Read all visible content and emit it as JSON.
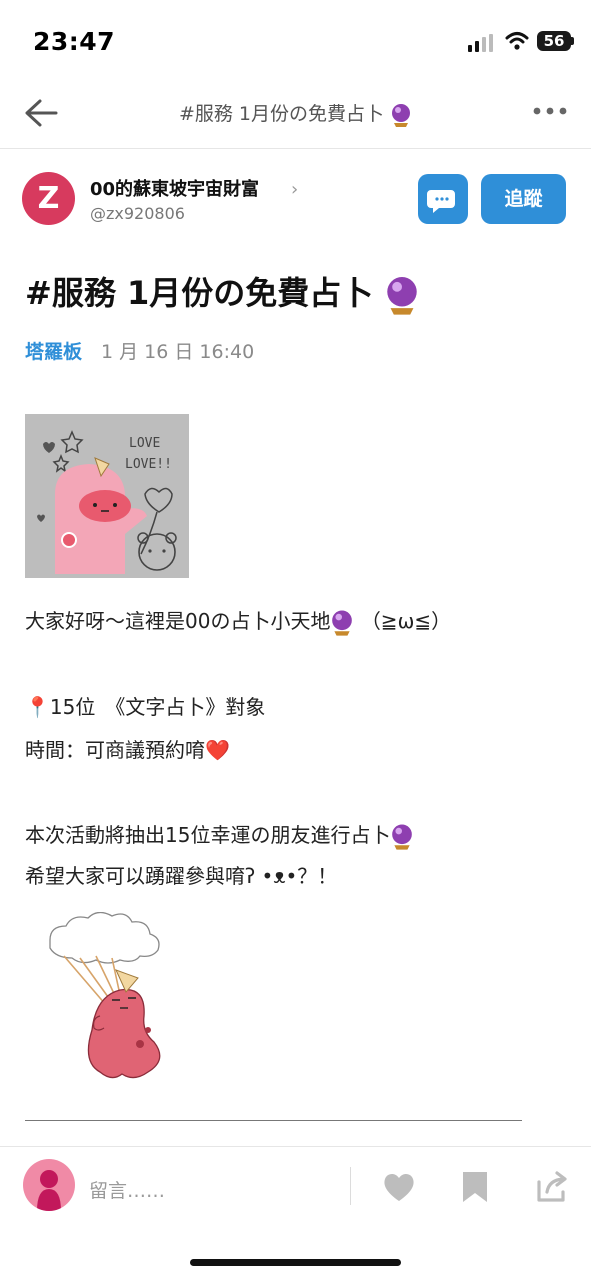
{
  "status_bar": {
    "time": "23:47",
    "battery": "56"
  },
  "nav": {
    "title": "#服務 1月份の免費占卜"
  },
  "author": {
    "avatar_letter": "Z",
    "name": "00的蘇東坡宇宙財富",
    "handle": "@zx920806",
    "follow_label": "追蹤"
  },
  "article": {
    "title": "#服務 1月份の免費占卜",
    "category": "塔羅板",
    "date": "1 月 16 日 16:40",
    "sticker_text": [
      "LOVE",
      "LOVE!!"
    ],
    "lines": [
      {
        "text": "大家好呀～這裡是00の占卜小天地",
        "suffix": "（≧ω≦）"
      },
      {
        "pin": "📍",
        "text": "15位　《文字占卜》對象"
      },
      {
        "text": "時間：可商議預約唷",
        "emoji": "❤️"
      },
      {
        "text": "本次活動將抽出15位幸運の朋友進行占卜"
      },
      {
        "text": "希望大家可以踴躍參與唷ʔ •ᴥ•？！"
      }
    ]
  },
  "bottom_bar": {
    "comment_placeholder": "留言……"
  },
  "colors": {
    "accent": "#2f8fd8",
    "avatar": "#d73a5e",
    "orb": "#8e3fb0"
  }
}
